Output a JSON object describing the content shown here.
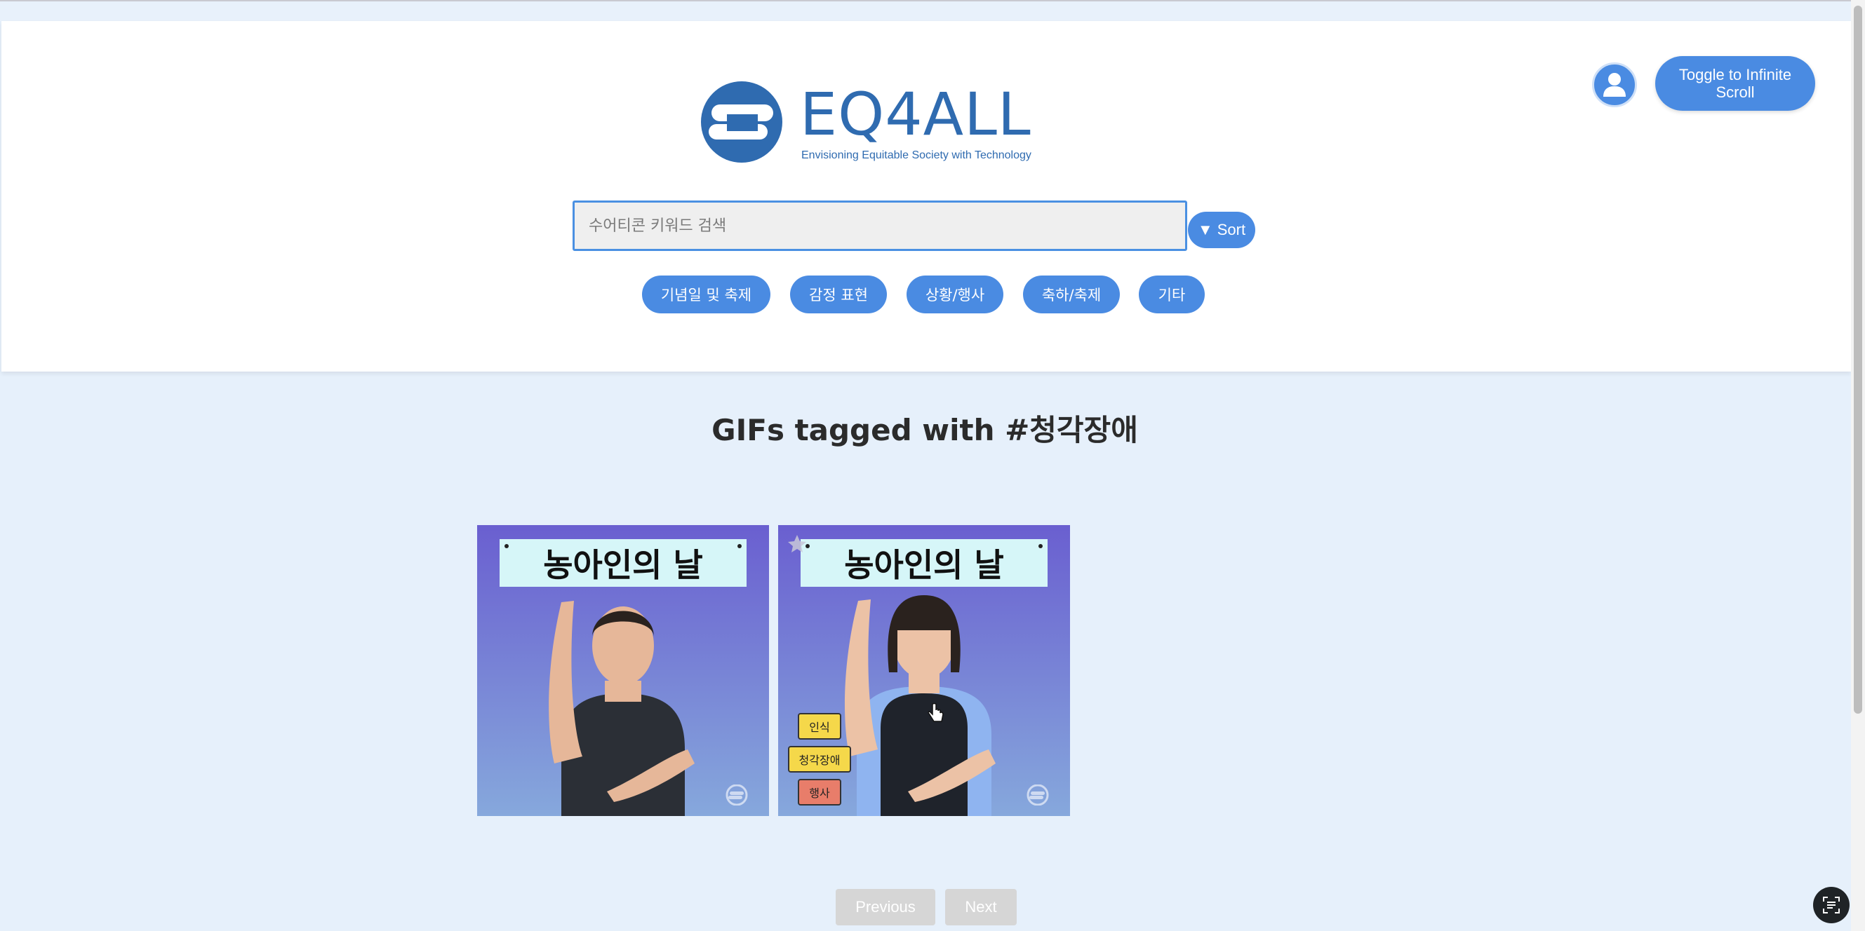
{
  "logo": {
    "text": "EQ4ALL",
    "tagline": "Envisioning Equitable Society with Technology"
  },
  "search": {
    "placeholder": "수어티콘 키워드 검색"
  },
  "sort": {
    "label": "Sort",
    "icon": "▼"
  },
  "categories": [
    "기념일 및 축제",
    "감정 표현",
    "상황/행사",
    "축하/축제",
    "기타"
  ],
  "user": {
    "icon": "user-icon"
  },
  "toggle": {
    "label": "Toggle to Infinite Scroll"
  },
  "page_title": "GIFs tagged with #청각장애",
  "gifs": [
    {
      "banner": "농아인의 날"
    },
    {
      "banner": "농아인의 날",
      "tags": [
        "인식",
        "청각장애",
        "행사"
      ]
    }
  ],
  "pagination": {
    "previous": "Previous",
    "next": "Next"
  },
  "colors": {
    "accent": "#4a8be2",
    "logo": "#2f6bb0",
    "background": "#e6f0fb"
  }
}
